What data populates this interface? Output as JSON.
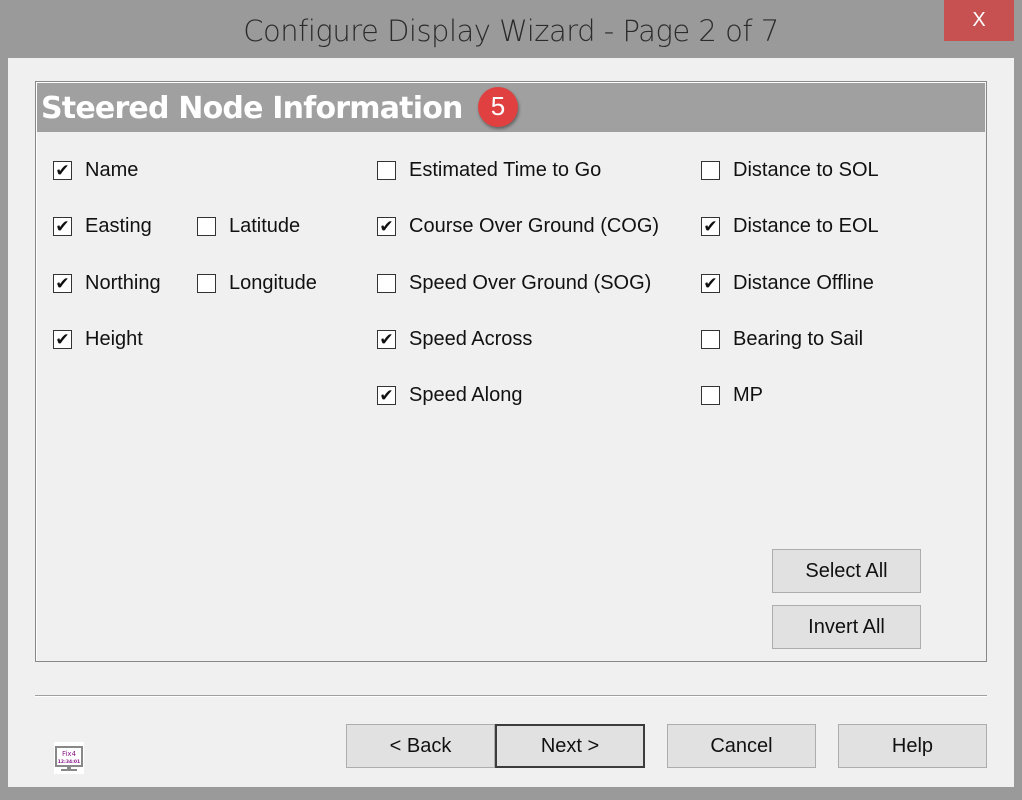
{
  "window": {
    "title": "Configure Display Wizard - Page 2 of 7",
    "close_label": "X"
  },
  "section": {
    "title": "Steered Node Information",
    "badge": "5"
  },
  "checkboxes": [
    {
      "label": "Name",
      "checked": true
    },
    {
      "label": "Easting",
      "checked": true
    },
    {
      "label": "Latitude",
      "checked": false
    },
    {
      "label": "Northing",
      "checked": true
    },
    {
      "label": "Longitude",
      "checked": false
    },
    {
      "label": "Height",
      "checked": true
    },
    {
      "label": "Estimated Time to Go",
      "checked": false
    },
    {
      "label": "Course Over Ground (COG)",
      "checked": true
    },
    {
      "label": "Speed Over Ground (SOG)",
      "checked": false
    },
    {
      "label": "Speed Across",
      "checked": true
    },
    {
      "label": "Speed Along",
      "checked": true
    },
    {
      "label": "Distance to SOL",
      "checked": false
    },
    {
      "label": "Distance to EOL",
      "checked": true
    },
    {
      "label": "Distance Offline",
      "checked": true
    },
    {
      "label": "Bearing to Sail",
      "checked": false
    },
    {
      "label": "MP",
      "checked": false
    }
  ],
  "buttons": {
    "select_all": "Select All",
    "invert_all": "Invert All",
    "back": "< Back",
    "next": "Next >",
    "cancel": "Cancel",
    "help": "Help"
  },
  "logo": {
    "line1": "Fix4",
    "line2": "12:34:01"
  }
}
